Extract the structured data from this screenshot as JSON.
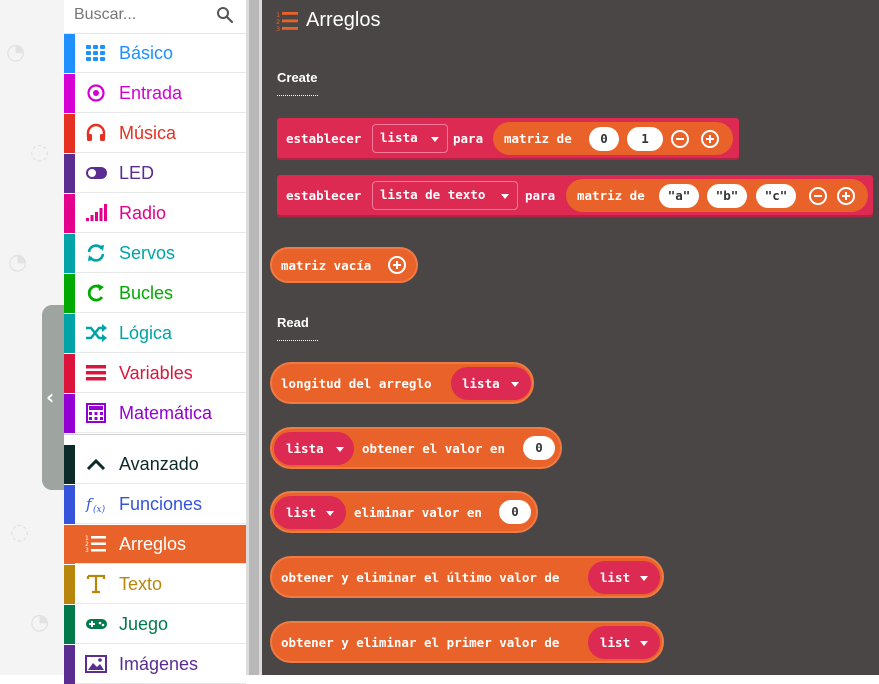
{
  "search": {
    "placeholder": "Buscar..."
  },
  "categories": [
    {
      "label": "Básico",
      "color": "#1e90ff",
      "icon": "grid-icon"
    },
    {
      "label": "Entrada",
      "color": "#d400d4",
      "icon": "target-icon"
    },
    {
      "label": "Música",
      "color": "#e63022",
      "icon": "headphones-icon"
    },
    {
      "label": "LED",
      "color": "#5c2d91",
      "icon": "toggle-icon"
    },
    {
      "label": "Radio",
      "color": "#e3008c",
      "icon": "signal-bars-icon"
    },
    {
      "label": "Servos",
      "color": "#00a4a6",
      "icon": "refresh-icon"
    },
    {
      "label": "Bucles",
      "color": "#00aa00",
      "icon": "loop-icon"
    },
    {
      "label": "Lógica",
      "color": "#00a4a6",
      "icon": "shuffle-icon"
    },
    {
      "label": "Variables",
      "color": "#dc143c",
      "icon": "list-lines-icon"
    },
    {
      "label": "Matemática",
      "color": "#9400d3",
      "icon": "calculator-icon"
    },
    {
      "label": "Avanzado",
      "color": "#0d2a2a",
      "icon": "chevron-up-icon"
    },
    {
      "label": "Funciones",
      "color": "#3455db",
      "icon": "function-icon"
    },
    {
      "label": "Arreglos",
      "color": "#e8622a",
      "icon": "numbered-list-icon"
    },
    {
      "label": "Texto",
      "color": "#b8860b",
      "icon": "text-icon"
    },
    {
      "label": "Juego",
      "color": "#007a4b",
      "icon": "gamepad-icon"
    },
    {
      "label": "Imágenes",
      "color": "#5c2d91",
      "icon": "image-icon"
    }
  ],
  "flyout": {
    "title": "Arreglos",
    "section_create": "Create",
    "section_read": "Read",
    "blocks": {
      "b1": {
        "kw1": "establecer",
        "var": "lista",
        "kw2": "para",
        "kw3": "matriz de",
        "v1": "0",
        "v2": "1"
      },
      "b2": {
        "kw1": "establecer",
        "var": "lista de texto",
        "kw2": "para",
        "kw3": "matriz de",
        "v1": "\"a\"",
        "v2": "\"b\"",
        "v3": "\"c\""
      },
      "b3": {
        "kw1": "matriz vacía"
      },
      "b4": {
        "kw1": "longitud del arreglo",
        "var": "lista"
      },
      "b5": {
        "var": "lista",
        "kw1": "obtener el valor en",
        "v1": "0"
      },
      "b6": {
        "var": "list",
        "kw1": "eliminar valor en",
        "v1": "0"
      },
      "b7": {
        "kw1": "obtener y eliminar el último valor de",
        "var": "list"
      },
      "b8": {
        "kw1": "obtener y eliminar el primer valor de",
        "var": "list"
      }
    }
  },
  "colors": {
    "flyout_bg": "#4a4646",
    "array_orange": "#e8622a",
    "variable_red": "#dd2a52"
  }
}
